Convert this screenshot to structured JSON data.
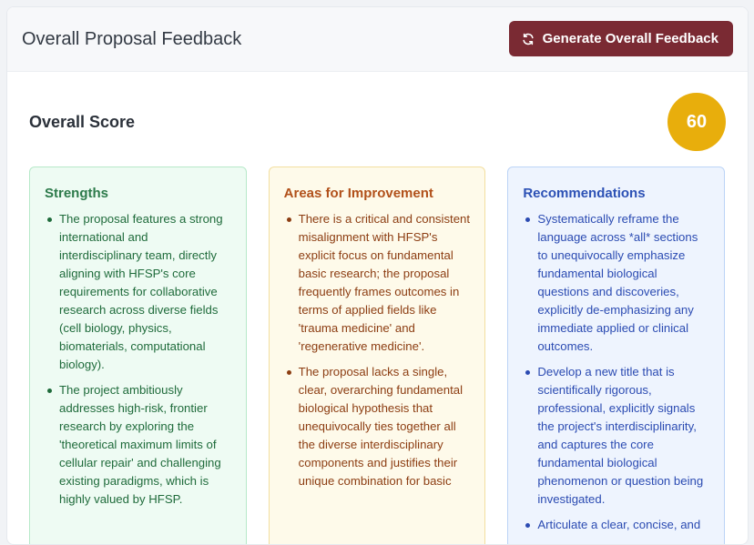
{
  "header": {
    "title": "Overall Proposal Feedback",
    "generate_button_label": "Generate Overall Feedback",
    "generate_button_icon": "refresh-icon"
  },
  "score": {
    "label": "Overall Score",
    "value": "60",
    "badge_color": "#e8ae0c"
  },
  "colors": {
    "button": "#7a2a33",
    "strengths": "#2c7a4a",
    "improvement": "#b1501a",
    "recommendations": "#2c51b5"
  },
  "strengths": {
    "title": "Strengths",
    "items": [
      "The proposal features a strong international and interdisciplinary team, directly aligning with HFSP's core requirements for collaborative research across diverse fields (cell biology, physics, biomaterials, computational biology).",
      "The project ambitiously addresses high-risk, frontier research by exploring the 'theoretical maximum limits of cellular repair' and challenging existing paradigms, which is highly valued by HFSP."
    ]
  },
  "improvement": {
    "title": "Areas for Improvement",
    "items": [
      "There is a critical and consistent misalignment with HFSP's explicit focus on fundamental basic research; the proposal frequently frames outcomes in terms of applied fields like 'trauma medicine' and 'regenerative medicine'.",
      "The proposal lacks a single, clear, overarching fundamental biological hypothesis that unequivocally ties together all the diverse interdisciplinary components and justifies their unique combination for basic"
    ]
  },
  "recommendations": {
    "title": "Recommendations",
    "items": [
      "Systematically reframe the language across *all* sections to unequivocally emphasize fundamental biological questions and discoveries, explicitly de-emphasizing any immediate applied or clinical outcomes.",
      "Develop a new title that is scientifically rigorous, professional, explicitly signals the project's interdisciplinarity, and captures the core fundamental biological phenomenon or question being investigated.",
      "Articulate a clear, concise, and"
    ]
  }
}
